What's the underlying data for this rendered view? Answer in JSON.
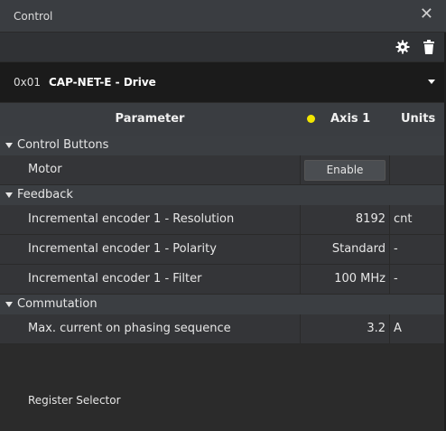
{
  "window": {
    "title": "Control"
  },
  "drive": {
    "address": "0x01",
    "name": "CAP-NET-E - Drive"
  },
  "table": {
    "headers": {
      "parameter": "Parameter",
      "axis": "Axis 1",
      "units": "Units"
    },
    "axis_status_color": "#f2e600",
    "groups": [
      {
        "label": "Control Buttons",
        "rows": [
          {
            "name": "Motor",
            "button": "Enable"
          }
        ]
      },
      {
        "label": "Feedback",
        "rows": [
          {
            "name": "Incremental encoder 1 - Resolution",
            "value": "8192",
            "unit": "cnt"
          },
          {
            "name": "Incremental encoder 1 - Polarity",
            "value": "Standard",
            "unit": "-"
          },
          {
            "name": "Incremental encoder 1 - Filter",
            "value": "100 MHz",
            "unit": "-"
          }
        ]
      },
      {
        "label": "Commutation",
        "rows": [
          {
            "name": "Max. current on phasing sequence",
            "value": "3.2",
            "unit": "A"
          }
        ]
      }
    ]
  },
  "footer": {
    "register_selector": "Register Selector"
  },
  "icons": {
    "close": "close-icon",
    "settings": "gear-icon",
    "delete": "trash-icon",
    "dropdown": "caret-down-icon"
  }
}
